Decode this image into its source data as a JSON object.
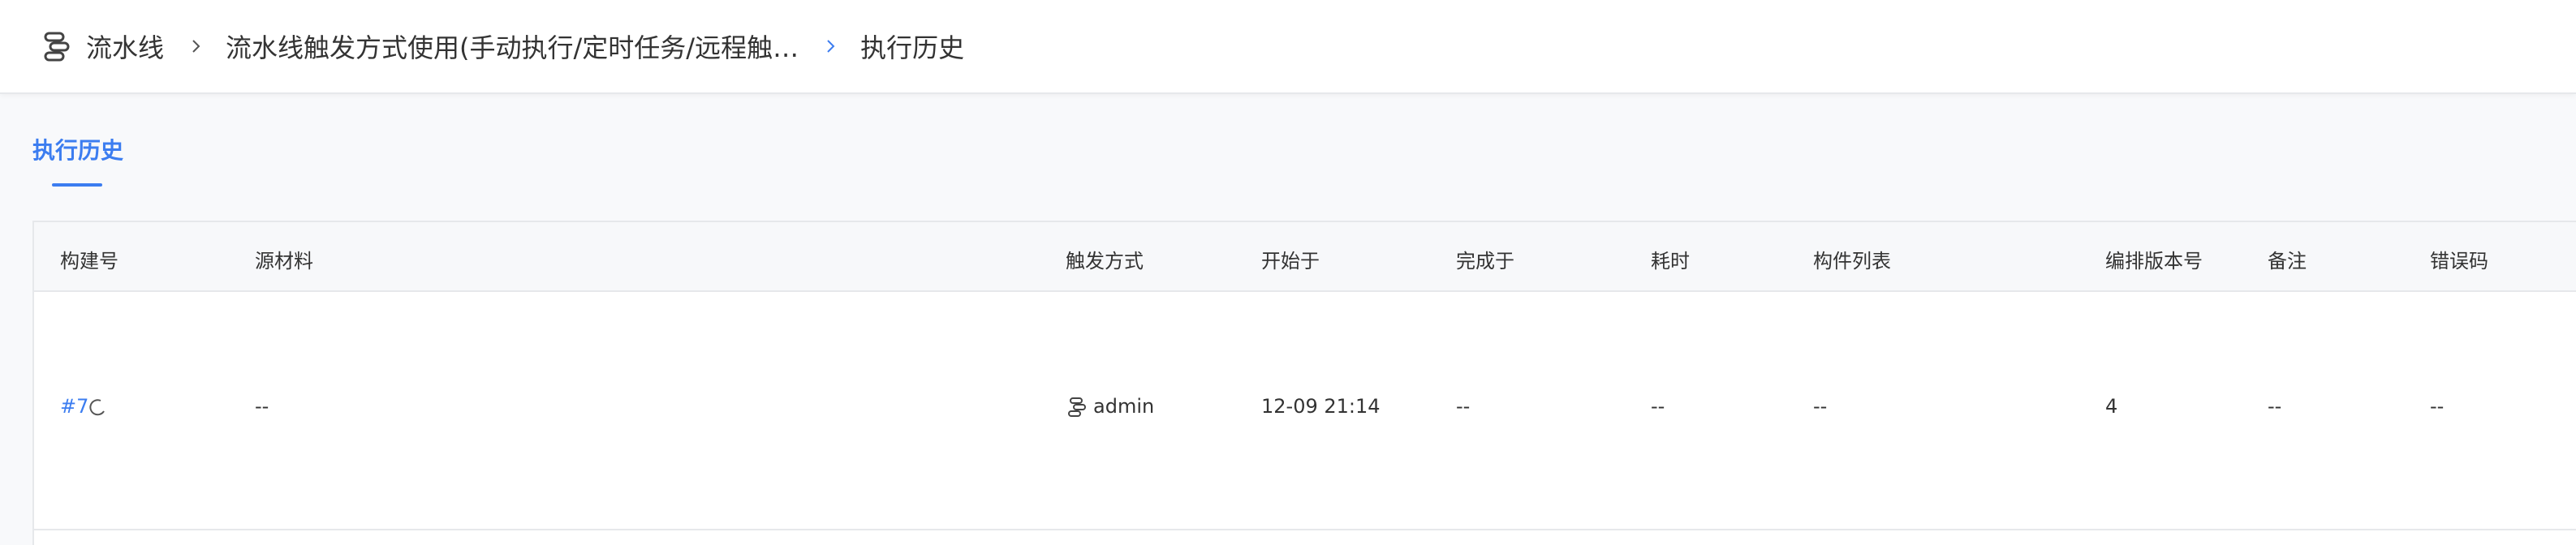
{
  "breadcrumb": {
    "items": [
      {
        "label": "流水线"
      },
      {
        "label": "流水线触发方式使用(手动执行/定时任务/远程触…"
      },
      {
        "label": "执行历史"
      }
    ]
  },
  "tabs": [
    {
      "label": "执行历史",
      "active": true
    }
  ],
  "table": {
    "columns": [
      "构建号",
      "源材料",
      "触发方式",
      "开始于",
      "完成于",
      "耗时",
      "构件列表",
      "编排版本号",
      "备注",
      "错误码"
    ],
    "rows": [
      {
        "build": "#7",
        "status": "running",
        "source": "--",
        "trigger": "admin",
        "start": "12-09 21:14",
        "finish": "--",
        "duration": "--",
        "artifacts": "--",
        "version": "4",
        "remark": "--",
        "error": "--"
      }
    ]
  },
  "colors": {
    "accent": "#3c7df0",
    "border": "#e6e8eb",
    "header_bg": "#f7f8fa"
  },
  "icons": {
    "pipeline": "pipeline-icon",
    "separator": "chevron-right-icon",
    "spinner": "loading-spinner-icon",
    "trigger": "trigger-user-icon"
  }
}
